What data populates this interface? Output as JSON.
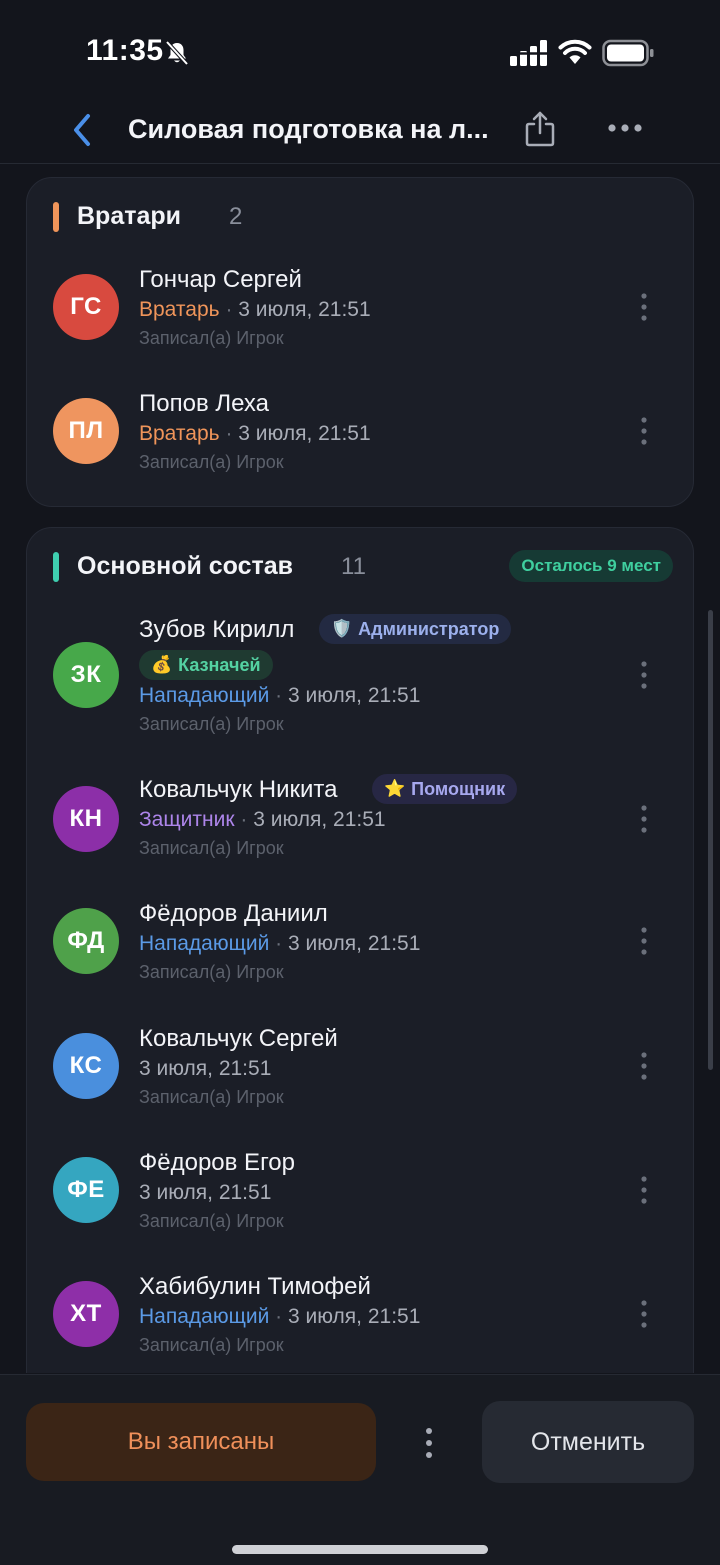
{
  "status_bar": {
    "time": "11:35",
    "icons": [
      "bell-slash-icon",
      "signal-icon",
      "wifi-icon",
      "battery-icon"
    ]
  },
  "nav": {
    "title": "Силовая подготовка на л...",
    "icons": [
      "back-chevron-icon",
      "share-icon",
      "more-horizontal-icon"
    ]
  },
  "colors": {
    "goalie_accent": "#f0955a",
    "main_accent": "#3fcfb0",
    "forward": "#5b9ae6",
    "defender": "#ad85ea"
  },
  "sections": {
    "goalies": {
      "title": "Вратари",
      "count": "2",
      "players": [
        {
          "initials": "ГС",
          "name": "Гончар Сергей",
          "role": "Вратарь",
          "sep": "·",
          "time": "3 июля, 21:51",
          "sub": "Записал(а) Игрок",
          "avatar_color": "#d84a3f"
        },
        {
          "initials": "ПЛ",
          "name": "Попов Леха",
          "role": "Вратарь",
          "sep": "·",
          "time": "3 июля, 21:51",
          "sub": "Записал(а) Игрок",
          "avatar_color": "#ef955f"
        }
      ]
    },
    "main": {
      "title": "Основной состав",
      "count": "11",
      "spots": "Осталось 9 мест",
      "players": [
        {
          "initials": "ЗК",
          "name": "Зубов Кирилл",
          "badge1": "Администратор",
          "badge1_emoji": "🛡️",
          "badge2": "Казначей",
          "badge2_emoji": "💰",
          "role": "Нападающий",
          "sep": "·",
          "time": "3 июля, 21:51",
          "sub": "Записал(а) Игрок",
          "avatar_color": "#47a84a"
        },
        {
          "initials": "КН",
          "name": "Ковальчук Никита",
          "badge1": "Помощник",
          "badge1_emoji": "⭐",
          "role": "Защитник",
          "sep": "·",
          "time": "3 июля, 21:51",
          "sub": "Записал(а) Игрок",
          "avatar_color": "#8c2fa8"
        },
        {
          "initials": "ФД",
          "name": "Фёдоров Даниил",
          "role": "Нападающий",
          "sep": "·",
          "time": "3 июля, 21:51",
          "sub": "Записал(а) Игрок",
          "avatar_color": "#4fa14a"
        },
        {
          "initials": "КС",
          "name": "Ковальчук Сергей",
          "time": "3 июля, 21:51",
          "sub": "Записал(а) Игрок",
          "avatar_color": "#4a8fdd"
        },
        {
          "initials": "ФЕ",
          "name": "Фёдоров Егор",
          "time": "3 июля, 21:51",
          "sub": "Записал(а) Игрок",
          "avatar_color": "#35a6c0"
        },
        {
          "initials": "ХТ",
          "name": "Хабибулин Тимофей",
          "role": "Нападающий",
          "sep": "·",
          "time": "3 июля, 21:51",
          "sub": "Записал(а) Игрок",
          "avatar_color": "#8e2fa8"
        }
      ]
    }
  },
  "bottom": {
    "primary_label": "Вы записаны",
    "cancel_label": "Отменить"
  }
}
